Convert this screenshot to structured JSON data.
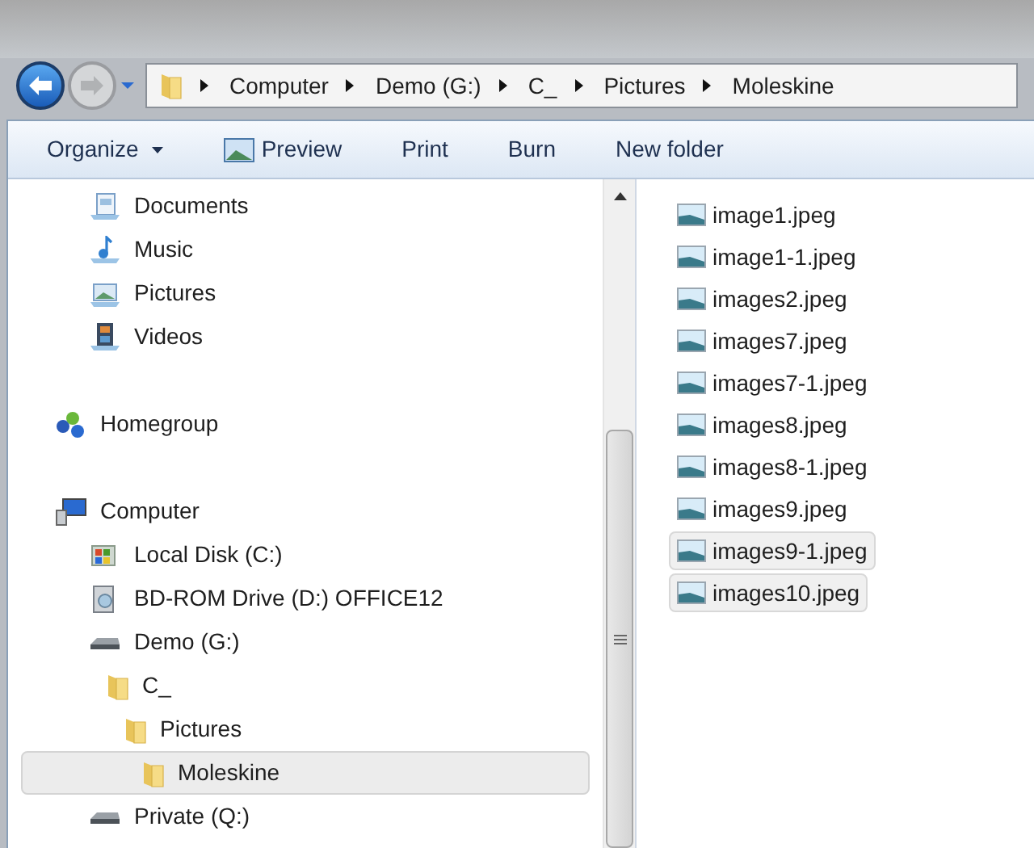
{
  "breadcrumb": [
    "Computer",
    "Demo (G:)",
    "C_",
    "Pictures",
    "Moleskine"
  ],
  "toolbar": [
    {
      "label": "Organize",
      "kind": "menu"
    },
    {
      "label": "Preview",
      "kind": "icon"
    },
    {
      "label": "Print",
      "kind": "plain"
    },
    {
      "label": "Burn",
      "kind": "plain"
    },
    {
      "label": "New folder",
      "kind": "plain"
    }
  ],
  "libraries": [
    {
      "label": "Documents",
      "kind": "documents",
      "selected": false
    },
    {
      "label": "Music",
      "kind": "music",
      "selected": false
    },
    {
      "label": "Pictures",
      "kind": "pictures",
      "selected": false
    },
    {
      "label": "Videos",
      "kind": "videos",
      "selected": false
    }
  ],
  "homegroup": {
    "label": "Homegroup",
    "selected": false
  },
  "computer": {
    "label": "Computer",
    "selected": false,
    "children": [
      {
        "label": "Local Disk (C:)",
        "kind": "disk",
        "selected": false
      },
      {
        "label": "BD-ROM Drive (D:) OFFICE12",
        "kind": "optical",
        "selected": false
      },
      {
        "label": "Demo (G:)",
        "kind": "drive",
        "selected": false,
        "children": [
          {
            "label": "C_",
            "kind": "folder",
            "selected": false,
            "children": [
              {
                "label": "Pictures",
                "kind": "folder",
                "selected": false,
                "children": [
                  {
                    "label": "Moleskine",
                    "kind": "folder",
                    "selected": true
                  }
                ]
              }
            ]
          }
        ]
      },
      {
        "label": "Private (Q:)",
        "kind": "drive",
        "selected": false
      }
    ]
  },
  "files": [
    {
      "name": "image1.jpeg",
      "selected": false
    },
    {
      "name": "image1-1.jpeg",
      "selected": false
    },
    {
      "name": "images2.jpeg",
      "selected": false
    },
    {
      "name": "images7.jpeg",
      "selected": false
    },
    {
      "name": "images7-1.jpeg",
      "selected": false
    },
    {
      "name": "images8.jpeg",
      "selected": false
    },
    {
      "name": "images8-1.jpeg",
      "selected": false
    },
    {
      "name": "images9.jpeg",
      "selected": false
    },
    {
      "name": "images9-1.jpeg",
      "selected": true
    },
    {
      "name": "images10.jpeg",
      "selected": true
    }
  ]
}
